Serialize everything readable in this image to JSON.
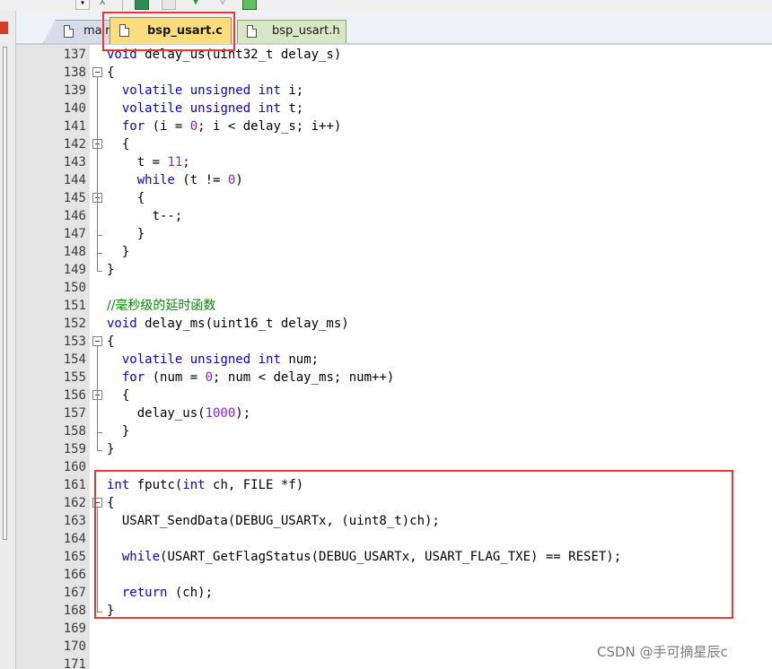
{
  "toolbar": {
    "icons": [
      "dropdown-icon",
      "branch-icon",
      "window-icon",
      "window-restore-icon",
      "download-icon",
      "filter-icon",
      "picture-icon"
    ]
  },
  "tabs": [
    {
      "label": "main.c",
      "active": false
    },
    {
      "label": "bsp_usart.c",
      "active": true
    },
    {
      "label": "bsp_usart.h",
      "active": false
    }
  ],
  "editor": {
    "lines": [
      {
        "num": "137",
        "segments": [
          {
            "t": "void",
            "c": "kw"
          },
          {
            "t": " delay_us(uint32_t delay_s)"
          }
        ]
      },
      {
        "num": "138",
        "segments": [
          {
            "t": "{"
          }
        ]
      },
      {
        "num": "139",
        "segments": [
          {
            "t": "  "
          },
          {
            "t": "volatile",
            "c": "kw"
          },
          {
            "t": " "
          },
          {
            "t": "unsigned",
            "c": "kw"
          },
          {
            "t": " "
          },
          {
            "t": "int",
            "c": "kw"
          },
          {
            "t": " i;"
          }
        ]
      },
      {
        "num": "140",
        "segments": [
          {
            "t": "  "
          },
          {
            "t": "volatile",
            "c": "kw"
          },
          {
            "t": " "
          },
          {
            "t": "unsigned",
            "c": "kw"
          },
          {
            "t": " "
          },
          {
            "t": "int",
            "c": "kw"
          },
          {
            "t": " t;"
          }
        ]
      },
      {
        "num": "141",
        "segments": [
          {
            "t": "  "
          },
          {
            "t": "for",
            "c": "kw"
          },
          {
            "t": " (i = "
          },
          {
            "t": "0",
            "c": "num"
          },
          {
            "t": "; i < delay_s; i++)"
          }
        ]
      },
      {
        "num": "142",
        "segments": [
          {
            "t": "  {"
          }
        ]
      },
      {
        "num": "143",
        "segments": [
          {
            "t": "    t = "
          },
          {
            "t": "11",
            "c": "num"
          },
          {
            "t": ";"
          }
        ]
      },
      {
        "num": "144",
        "segments": [
          {
            "t": "    "
          },
          {
            "t": "while",
            "c": "kw"
          },
          {
            "t": " (t != "
          },
          {
            "t": "0",
            "c": "num"
          },
          {
            "t": ")"
          }
        ]
      },
      {
        "num": "145",
        "segments": [
          {
            "t": "    {"
          }
        ]
      },
      {
        "num": "146",
        "segments": [
          {
            "t": "      t--;"
          }
        ]
      },
      {
        "num": "147",
        "segments": [
          {
            "t": "    }"
          }
        ]
      },
      {
        "num": "148",
        "segments": [
          {
            "t": "  }"
          }
        ]
      },
      {
        "num": "149",
        "segments": [
          {
            "t": "}"
          }
        ]
      },
      {
        "num": "150",
        "segments": []
      },
      {
        "num": "151",
        "segments": [
          {
            "t": "//毫秒级的延时函数",
            "c": "cm"
          }
        ]
      },
      {
        "num": "152",
        "segments": [
          {
            "t": "void",
            "c": "kw"
          },
          {
            "t": " delay_ms(uint16_t delay_ms)"
          }
        ]
      },
      {
        "num": "153",
        "segments": [
          {
            "t": "{"
          }
        ]
      },
      {
        "num": "154",
        "segments": [
          {
            "t": "  "
          },
          {
            "t": "volatile",
            "c": "kw"
          },
          {
            "t": " "
          },
          {
            "t": "unsigned",
            "c": "kw"
          },
          {
            "t": " "
          },
          {
            "t": "int",
            "c": "kw"
          },
          {
            "t": " num;"
          }
        ]
      },
      {
        "num": "155",
        "segments": [
          {
            "t": "  "
          },
          {
            "t": "for",
            "c": "kw"
          },
          {
            "t": " (num = "
          },
          {
            "t": "0",
            "c": "num"
          },
          {
            "t": "; num < delay_ms; num++)"
          }
        ]
      },
      {
        "num": "156",
        "segments": [
          {
            "t": "  {"
          }
        ]
      },
      {
        "num": "157",
        "segments": [
          {
            "t": "    delay_us("
          },
          {
            "t": "1000",
            "c": "num"
          },
          {
            "t": ");"
          }
        ]
      },
      {
        "num": "158",
        "segments": [
          {
            "t": "  }"
          }
        ]
      },
      {
        "num": "159",
        "segments": [
          {
            "t": "}"
          }
        ]
      },
      {
        "num": "160",
        "segments": []
      },
      {
        "num": "161",
        "segments": [
          {
            "t": "int",
            "c": "kw"
          },
          {
            "t": " fputc("
          },
          {
            "t": "int",
            "c": "kw"
          },
          {
            "t": " ch, FILE *f)"
          }
        ]
      },
      {
        "num": "162",
        "segments": [
          {
            "t": "{"
          }
        ]
      },
      {
        "num": "163",
        "segments": [
          {
            "t": "  USART_SendData(DEBUG_USARTx, (uint8_t)ch);"
          }
        ]
      },
      {
        "num": "164",
        "segments": []
      },
      {
        "num": "165",
        "segments": [
          {
            "t": "  "
          },
          {
            "t": "while",
            "c": "kw"
          },
          {
            "t": "(USART_GetFlagStatus(DEBUG_USARTx, USART_FLAG_TXE) == RESET);"
          }
        ]
      },
      {
        "num": "166",
        "segments": []
      },
      {
        "num": "167",
        "segments": [
          {
            "t": "  "
          },
          {
            "t": "return",
            "c": "kw"
          },
          {
            "t": " (ch);"
          }
        ]
      },
      {
        "num": "168",
        "segments": [
          {
            "t": "}"
          }
        ]
      },
      {
        "num": "169",
        "segments": []
      },
      {
        "num": "170",
        "segments": []
      },
      {
        "num": "171",
        "segments": []
      }
    ]
  },
  "colors": {
    "keyword": "#0000e0",
    "number": "#8a1fd6",
    "comment": "#008a00",
    "highlight": "#e53935",
    "active_tab": "#fddd7d"
  },
  "watermark": "CSDN @手可摘星辰c"
}
